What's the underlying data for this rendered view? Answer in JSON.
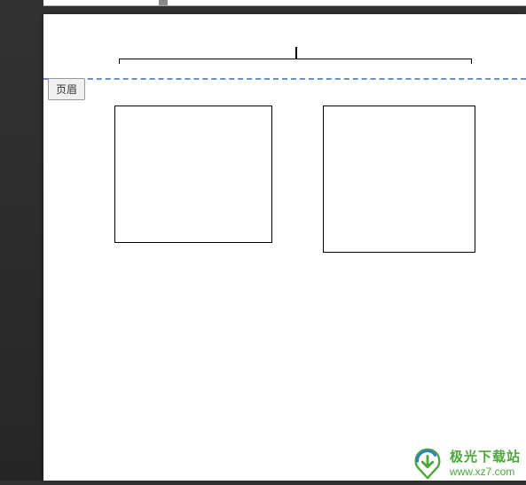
{
  "header": {
    "tag_label": "页眉"
  },
  "shapes": {
    "box1": "",
    "box2": ""
  },
  "watermark": {
    "title": "极光下载站",
    "url": "www.xz7.com"
  }
}
